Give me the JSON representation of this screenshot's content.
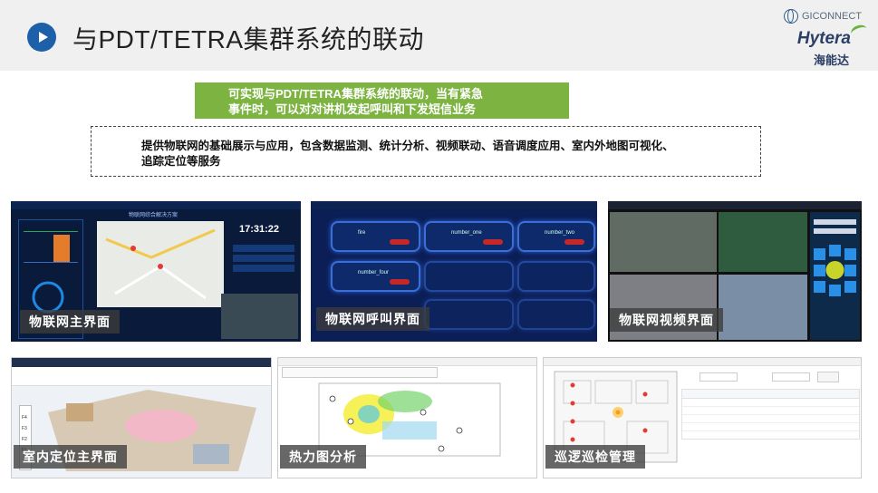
{
  "title": "与PDT/TETRA集群系统的联动",
  "brand": {
    "giconnect": "GICONNECT",
    "hytera": "Hytera",
    "hytera_cn": "海能达"
  },
  "green_box": {
    "line1": "可实现与PDT/TETRA集群系统的联动，当有紧急",
    "line2": "事件时，可以对对讲机发起呼叫和下发短信业务"
  },
  "dashed_box": {
    "line1": "提供物联网的基础展示与应用，包含数据监测、统计分析、视频联动、语音调度应用、室内外地图可视化、",
    "line2": "追踪定位等服务"
  },
  "panels": {
    "iot_main": {
      "caption": "物联网主界面",
      "header": "物联网综合解决方案",
      "clock": "17:31:22"
    },
    "iot_call": {
      "caption": "物联网呼叫界面",
      "tiles": [
        "fire",
        "number_one",
        "number_two",
        "number_four"
      ]
    },
    "iot_video": {
      "caption": "物联网视频界面"
    },
    "indoor": {
      "caption": "室内定位主界面",
      "floors": [
        "F4",
        "F3",
        "F2",
        "F1"
      ]
    },
    "heatmap": {
      "caption": "热力图分析"
    },
    "patrol": {
      "caption": "巡逻巡检管理"
    }
  },
  "colors": {
    "header_bg": "#f0f0f0",
    "accent_blue": "#1d5fa8",
    "green": "#7cb341",
    "caption_bg": "#3c3c3c"
  }
}
